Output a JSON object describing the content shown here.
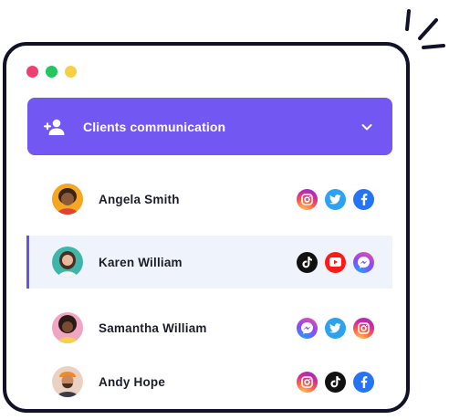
{
  "window": {
    "dots": [
      "#ef3f6f",
      "#22c55e",
      "#f7cf45"
    ]
  },
  "header": {
    "title": "Clients communication",
    "icon": "add-user-icon",
    "chevron": "chevron-down-icon",
    "background": "#7357f2"
  },
  "clients": [
    {
      "name": "Angela Smith",
      "avatar_bg": "#f5a623",
      "socials": [
        "instagram",
        "twitter",
        "facebook"
      ],
      "selected": false
    },
    {
      "name": "Karen William",
      "avatar_bg": "#3fb6a9",
      "socials": [
        "tiktok",
        "youtube",
        "messenger"
      ],
      "selected": true
    },
    {
      "name": "Samantha William",
      "avatar_bg": "#f0a6c2",
      "socials": [
        "messenger",
        "twitter",
        "instagram"
      ],
      "selected": false
    },
    {
      "name": "Andy Hope",
      "avatar_bg": "#e9d2c2",
      "socials": [
        "instagram",
        "tiktok",
        "facebook"
      ],
      "selected": false
    }
  ]
}
